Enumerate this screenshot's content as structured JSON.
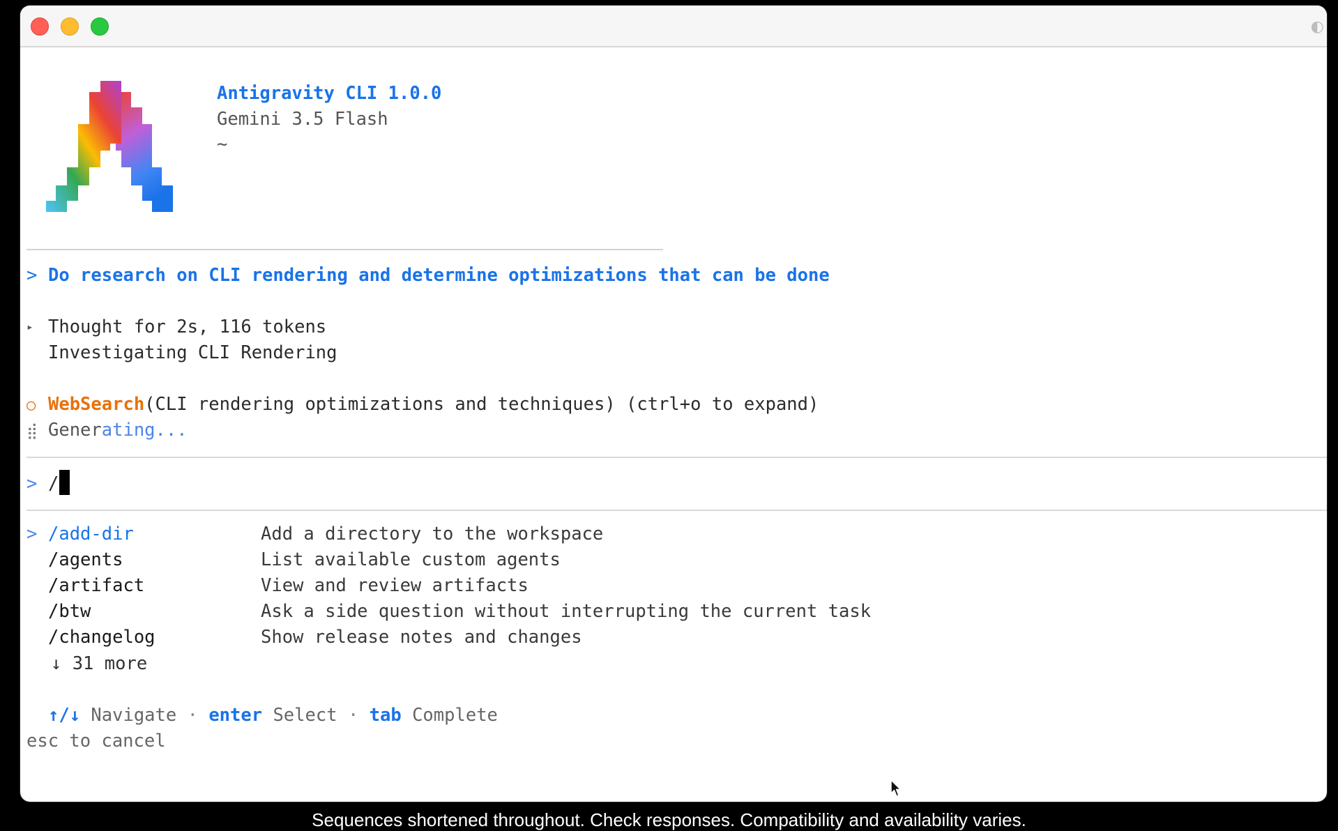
{
  "app": {
    "name": "Antigravity CLI 1.0.0",
    "model": "Gemini 3.5 Flash",
    "cwd": "~"
  },
  "colors": {
    "accent": "#1a73e8",
    "tool": "#e8710a",
    "close": "#fe5f57",
    "minimize": "#febc2e",
    "maximize": "#28c840"
  },
  "icons": {
    "logo": "antigravity-logo-icon",
    "prompt": "chevron-right-icon",
    "thought": "triangle-right-icon",
    "tool_status": "circle-outline-icon",
    "spinner": "braille-spinner-icon",
    "pointer": "mouse-pointer-icon"
  },
  "conversation": {
    "prompt_chevron": ">",
    "user_prompt": "Do research on CLI rendering and determine optimizations that can be done",
    "thought_triangle": "▸",
    "thought_summary": "Thought for 2s, 116 tokens",
    "thought_title": "Investigating CLI Rendering",
    "tool_circle": "○",
    "tool_name": "WebSearch",
    "tool_args": "(CLI rendering optimizations and techniques) (ctrl+o to expand)",
    "spinner_glyph": "⣾",
    "generating_a": "Gener",
    "generating_b": "ating..."
  },
  "input": {
    "chevron": ">",
    "value": "/"
  },
  "commands": {
    "selector": ">",
    "items": [
      {
        "name": "/add-dir",
        "description": "Add a directory to the workspace"
      },
      {
        "name": "/agents",
        "description": "List available custom agents"
      },
      {
        "name": "/artifact",
        "description": "View and review artifacts"
      },
      {
        "name": "/btw",
        "description": "Ask a side question without interrupting the current task"
      },
      {
        "name": "/changelog",
        "description": "Show release notes and changes"
      }
    ],
    "more": "↓ 31 more"
  },
  "footer": {
    "nav_key": "↑/↓",
    "nav_label": "Navigate",
    "separator": "·",
    "enter_key": "enter",
    "enter_label": "Select",
    "tab_key": "tab",
    "tab_label": "Complete",
    "esc": "esc to cancel"
  },
  "caption": "Sequences shortened throughout. Check responses. Compatibility and availability varies."
}
